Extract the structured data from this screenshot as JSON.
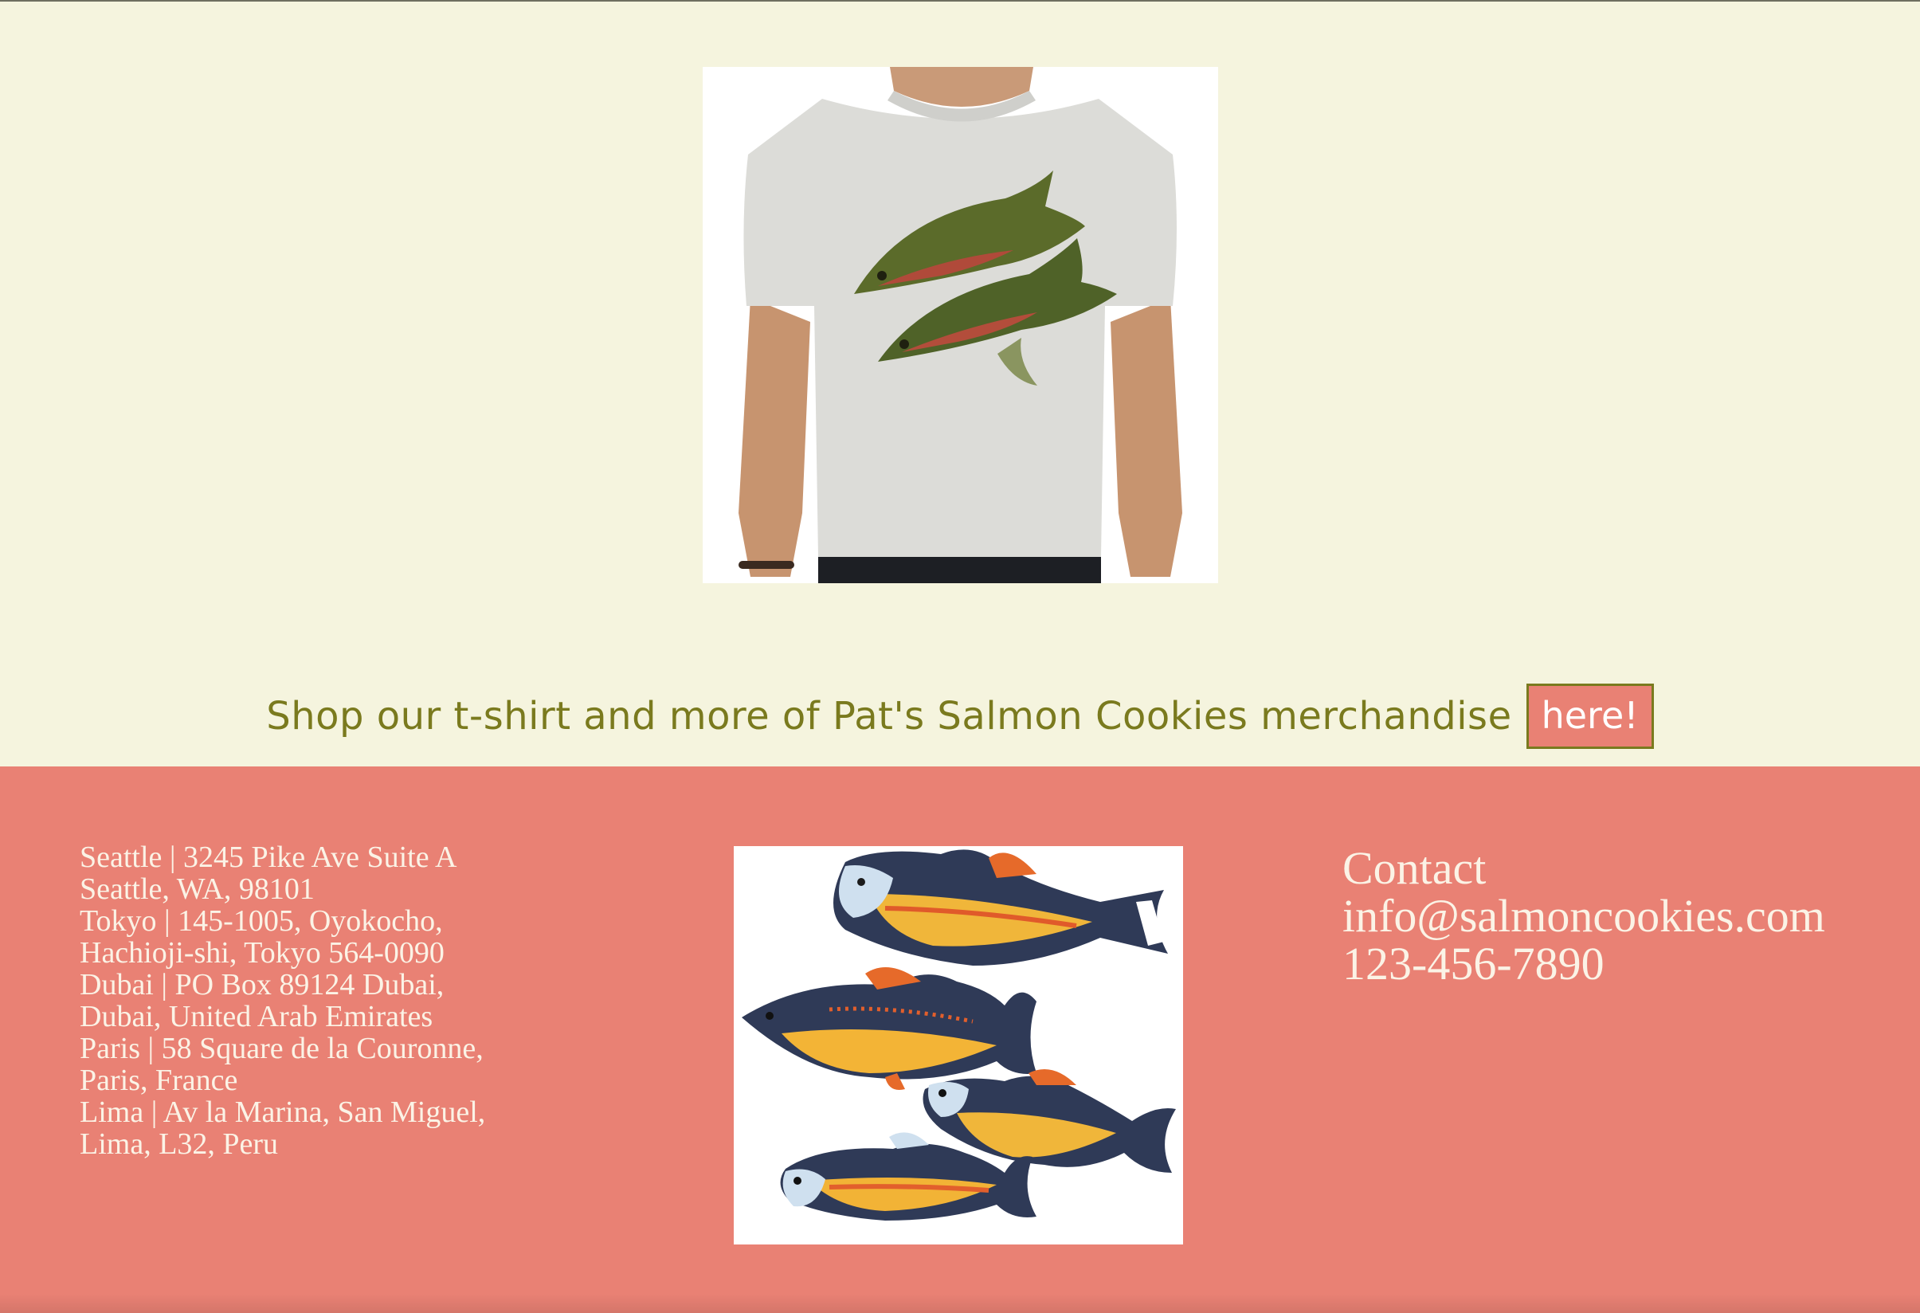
{
  "colors": {
    "page_background": "#f5f4de",
    "footer_background": "#e98174",
    "accent_text": "#7a7a1e",
    "footer_text": "#fbf3e6"
  },
  "merch": {
    "image_icon": "salmon-tshirt-image",
    "shop_text": "Shop our t-shirt and more of Pat's Salmon Cookies merchandise",
    "shop_link_label": "here!"
  },
  "footer": {
    "locations": [
      "Seattle | 3245 Pike Ave Suite A",
      "Seattle, WA, 98101",
      "Tokyo | 145-1005, Oyokocho,",
      "Hachioji-shi, Tokyo 564-0090",
      "Dubai | PO Box 89124 Dubai,",
      "Dubai, United Arab Emirates",
      "Paris | 58 Square de la Couronne,",
      "Paris, France",
      "Lima | Av la Marina, San Miguel,",
      "Lima, L32, Peru"
    ],
    "image_icon": "salmon-cookies-image",
    "contact": {
      "heading": "Contact",
      "email": "info@salmoncookies.com",
      "phone": "123-456-7890"
    }
  }
}
